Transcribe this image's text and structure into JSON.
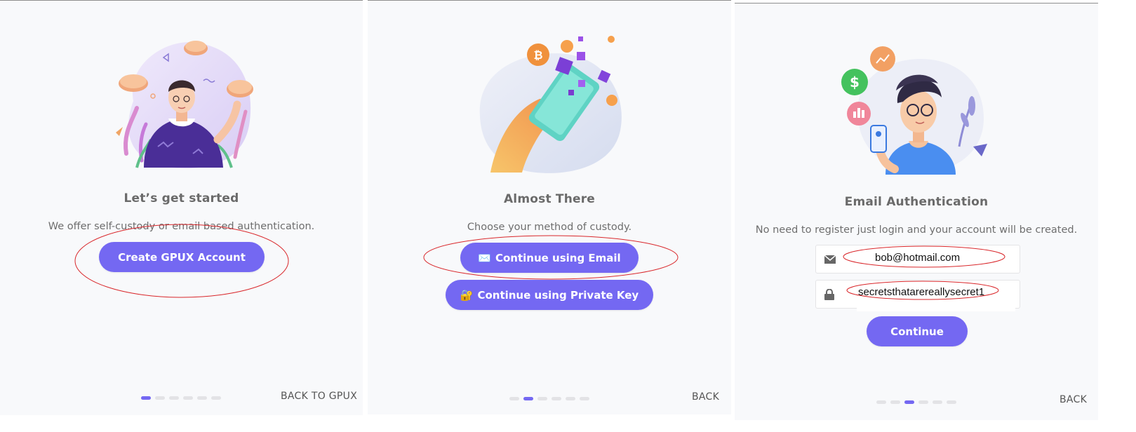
{
  "panels": [
    {
      "title": "Let’s get started",
      "description": "We offer self-custody or email based authentication.",
      "primary_button": "Create GPUX Account",
      "back_link": "BACK TO GPUX",
      "step_active": 1,
      "step_count": 6
    },
    {
      "title": "Almost There",
      "description": "Choose your method of custody.",
      "email_button": "Continue using Email",
      "email_button_emoji": "✉️",
      "private_key_button": "Continue using Private Key",
      "private_key_button_emoji": "🔐",
      "back_link": "BACK",
      "step_active": 2,
      "step_count": 6
    },
    {
      "title": "Email Authentication",
      "description": "No need to register just login and your account will be created.",
      "email_value": "bob@hotmail.com",
      "password_value": "secretsthatarereallysecret1",
      "continue_button": "Continue",
      "back_link": "BACK",
      "step_active": 3,
      "step_count": 6
    }
  ],
  "colors": {
    "accent": "#7468f2",
    "annotation": "#d9262a",
    "panel_bg": "#f8f9fb"
  },
  "icons": {
    "illustration_1": "person-with-coins-illustration",
    "illustration_2": "hand-holding-phone-crypto-illustration",
    "illustration_3": "person-with-phone-finance-illustration",
    "email_icon": "envelope-icon",
    "password_icon": "lock-icon"
  }
}
